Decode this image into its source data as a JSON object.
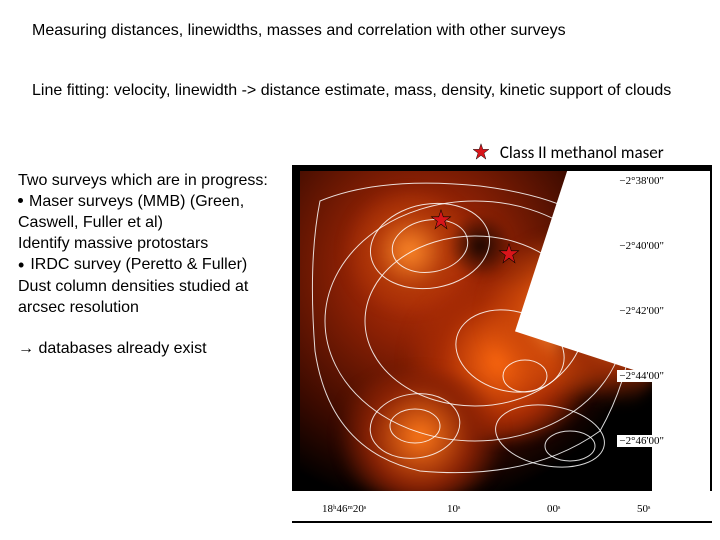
{
  "title": "Measuring distances, linewidths, masses and correlation with other surveys",
  "subtitle": "Line fitting: velocity, linewidth -> distance estimate, mass, density, kinetic support of clouds",
  "left": {
    "line1": "Two surveys which are in progress:",
    "line2": "Maser surveys (MMB) (Green,",
    "line3": "Caswell, Fuller et al)",
    "line4": "Identify massive protostars",
    "line5": "IRDC survey  (Peretto & Fuller)",
    "line6": "Dust column densities studied at",
    "line7": "arcsec resolution"
  },
  "arrow_line": "→ databases already exist",
  "legend": "Class II methanol maser",
  "yticks": {
    "t0": "−2°38'00\"",
    "t1": "−2°40'00\"",
    "t2": "−2°42'00\"",
    "t3": "−2°44'00\"",
    "t4": "−2°46'00\""
  },
  "xticks": {
    "x0": "18ʰ46ᵐ20ˢ",
    "x1": "10ˢ",
    "x2": "00ˢ",
    "x3": "50ˢ"
  },
  "colors": {
    "star": "#d8151a"
  }
}
